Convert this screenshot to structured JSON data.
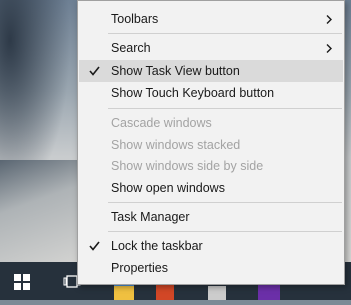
{
  "menu": {
    "toolbars": "Toolbars",
    "search": "Search",
    "show_task_view": "Show Task View button",
    "show_touch_keyboard": "Show Touch Keyboard button",
    "cascade": "Cascade windows",
    "stacked": "Show windows stacked",
    "side_by_side": "Show windows side by side",
    "open_windows": "Show open windows",
    "task_manager": "Task Manager",
    "lock_taskbar": "Lock the taskbar",
    "properties": "Properties"
  },
  "icons": {
    "submenu": "chevron-right-icon",
    "checked": "check-icon",
    "start": "windows-logo-icon",
    "task_view": "task-view-icon"
  },
  "colors": {
    "menu_bg": "#f2f2f2",
    "hover_bg": "#dadada",
    "disabled_text": "#a3a3a3",
    "taskbar_bg": "#26313c"
  }
}
